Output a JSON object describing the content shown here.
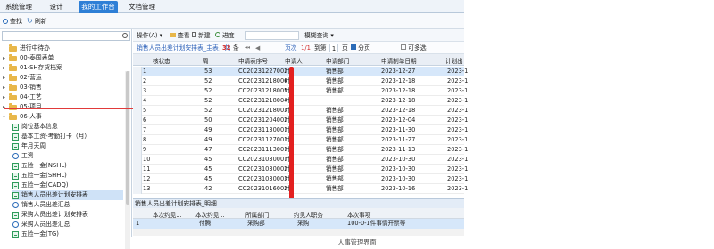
{
  "tabs": [
    "系统管理",
    "设计",
    "我的工作台",
    "文档管理"
  ],
  "active_tab": 2,
  "toolbar": {
    "search_label": "查找",
    "refresh_label": "刷新"
  },
  "tree": {
    "items": [
      {
        "label": "进行中待办",
        "kind": "folder",
        "arrow": ""
      },
      {
        "label": "00-泰国表单",
        "kind": "folder",
        "arrow": "▸"
      },
      {
        "label": "01-SH存货档案",
        "kind": "folder",
        "arrow": "▸"
      },
      {
        "label": "02-营运",
        "kind": "folder",
        "arrow": "▸"
      },
      {
        "label": "03-销售",
        "kind": "folder",
        "arrow": "▸"
      },
      {
        "label": "04-工艺",
        "kind": "folder",
        "arrow": "▸"
      },
      {
        "label": "05-项目",
        "kind": "folder",
        "arrow": "▸"
      },
      {
        "label": "06-人事",
        "kind": "folder",
        "arrow": "▾"
      },
      {
        "label": "岗位基本信息",
        "kind": "doc"
      },
      {
        "label": "基本工资-考勤打卡（月）",
        "kind": "doc"
      },
      {
        "label": "年月天周",
        "kind": "doc"
      },
      {
        "label": "工资",
        "kind": "mag"
      },
      {
        "label": "五险一金(NSHL)",
        "kind": "doc"
      },
      {
        "label": "五险一金(SHHL)",
        "kind": "doc"
      },
      {
        "label": "五险一金(CADQ)",
        "kind": "doc"
      },
      {
        "label": "销售人员出差计划安排表",
        "kind": "doc",
        "selected": true
      },
      {
        "label": "销售人员出差汇总",
        "kind": "mag"
      },
      {
        "label": "采购人员出差计划安排表",
        "kind": "doc"
      },
      {
        "label": "采购人员出差汇总",
        "kind": "mag"
      },
      {
        "label": "五险一金(TG)",
        "kind": "doc"
      }
    ]
  },
  "right": {
    "op_label": "操作(A)",
    "view_label": "查看",
    "new_label": "新建",
    "progress_label": "进度",
    "fuzzy_label": "模糊查询",
    "breadcrumb": "销售人员出差计划安排表_主表，共",
    "count": "32",
    "count_unit": "条",
    "page_label": "页次",
    "page_value": "1/1",
    "goto_label": "到第",
    "page_input": "1",
    "page_unit": "页",
    "paginate_label": "分页",
    "multi_label": "可多选",
    "columns": [
      "核状态",
      "周",
      "申请表序号",
      "申请人",
      "申请部门",
      "申请制单日期",
      "计划出"
    ],
    "rows": [
      {
        "n": "1",
        "week": "53",
        "code": "CC20231227002",
        "who": "叶",
        "dept": "销售部",
        "date": "2023-12-27",
        "plan": "2023-1"
      },
      {
        "n": "2",
        "week": "52",
        "code": "CC20231218006",
        "who": "叶",
        "dept": "销售部",
        "date": "2023-12-18",
        "plan": "2023-1"
      },
      {
        "n": "3",
        "week": "52",
        "code": "CC20231218005",
        "who": "叶",
        "dept": "销售部",
        "date": "2023-12-18",
        "plan": "2023-1"
      },
      {
        "n": "4",
        "week": "52",
        "code": "CC20231218004",
        "who": "叶",
        "dept": "",
        "date": "2023-12-18",
        "plan": "2023-1"
      },
      {
        "n": "5",
        "week": "52",
        "code": "CC20231218003",
        "who": "叶",
        "dept": "销售部",
        "date": "2023-12-18",
        "plan": "2023-1"
      },
      {
        "n": "6",
        "week": "50",
        "code": "CC20231204002",
        "who": "叶",
        "dept": "销售部",
        "date": "2023-12-04",
        "plan": "2023-1"
      },
      {
        "n": "7",
        "week": "49",
        "code": "CC20231130001",
        "who": "叶",
        "dept": "销售部",
        "date": "2023-11-30",
        "plan": "2023-1"
      },
      {
        "n": "8",
        "week": "49",
        "code": "CC20231127001",
        "who": "叶",
        "dept": "销售部",
        "date": "2023-11-27",
        "plan": "2023-1"
      },
      {
        "n": "9",
        "week": "47",
        "code": "CC20231113001",
        "who": "叶",
        "dept": "销售部",
        "date": "2023-11-13",
        "plan": "2023-1"
      },
      {
        "n": "10",
        "week": "45",
        "code": "CC20231030001",
        "who": "叶",
        "dept": "销售部",
        "date": "2023-10-30",
        "plan": "2023-1"
      },
      {
        "n": "11",
        "week": "45",
        "code": "CC20231030002",
        "who": "叶",
        "dept": "销售部",
        "date": "2023-10-30",
        "plan": "2023-1"
      },
      {
        "n": "12",
        "week": "45",
        "code": "CC20231030003",
        "who": "叶",
        "dept": "销售部",
        "date": "2023-10-30",
        "plan": "2023-1"
      },
      {
        "n": "13",
        "week": "42",
        "code": "CC20231016002",
        "who": "叶",
        "dept": "销售部",
        "date": "2023-10-16",
        "plan": "2023-1"
      }
    ],
    "detail_title": "销售人员出差计划安排表_明细",
    "detail_columns": [
      "本次约见...",
      "本次约见...",
      "所属部门",
      "约见人职务",
      "本次事项"
    ],
    "detail_row": [
      "1",
      "付腾",
      "采购部",
      "采购",
      "100-0-1件事情开票等"
    ]
  },
  "caption": "人事管理界面"
}
